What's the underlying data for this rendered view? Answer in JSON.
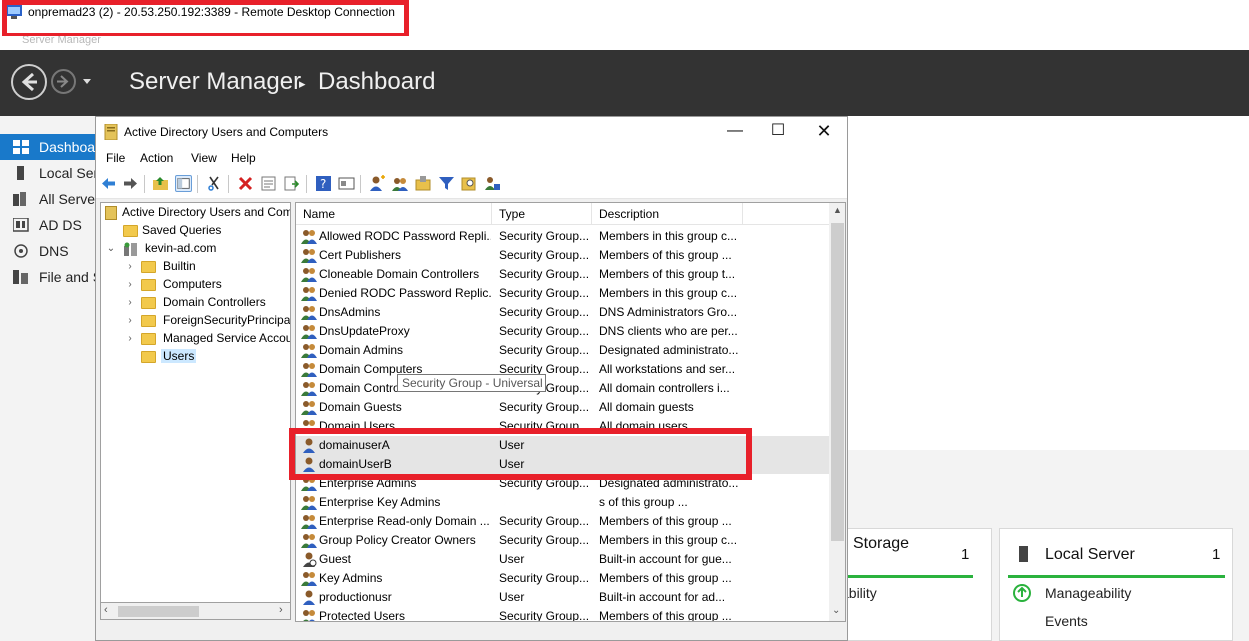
{
  "rdp": {
    "title": "onpremad23 (2) - 20.53.250.192:3389 - Remote Desktop Connection",
    "ghost_title": "Server Manager"
  },
  "header": {
    "app": "Server Manager",
    "page": "Dashboard"
  },
  "nav": [
    {
      "label": "Dashboard",
      "active": true,
      "icon": "dashboard-icon"
    },
    {
      "label": "Local Server",
      "icon": "server-icon"
    },
    {
      "label": "All Servers",
      "icon": "servers-icon"
    },
    {
      "label": "AD DS",
      "icon": "ad-ds-icon"
    },
    {
      "label": "DNS",
      "icon": "dns-icon"
    },
    {
      "label": "File and Storage Services",
      "icon": "file-storage-icon"
    }
  ],
  "tiles": {
    "storage": {
      "title": "Storage",
      "count": "1",
      "row1": "ability"
    },
    "local": {
      "title": "Local Server",
      "count": "1",
      "row1": "Manageability",
      "row2": "Events"
    }
  },
  "aduc": {
    "title": "Active Directory Users and Computers",
    "menu": [
      "File",
      "Action",
      "View",
      "Help"
    ],
    "tree": {
      "root": "Active Directory Users and Computers",
      "saved": "Saved Queries",
      "domain": "kevin-ad.com",
      "children": [
        "Builtin",
        "Computers",
        "Domain Controllers",
        "ForeignSecurityPrincipals",
        "Managed Service Accounts",
        "Users"
      ]
    },
    "columns": {
      "name": "Name",
      "type": "Type",
      "desc": "Description"
    },
    "rows": [
      {
        "name": "Allowed RODC Password Repli...",
        "type": "Security Group...",
        "desc": "Members in this group c...",
        "kind": "group"
      },
      {
        "name": "Cert Publishers",
        "type": "Security Group...",
        "desc": "Members of this group ...",
        "kind": "group"
      },
      {
        "name": "Cloneable Domain Controllers",
        "type": "Security Group...",
        "desc": "Members of this group t...",
        "kind": "group"
      },
      {
        "name": "Denied RODC Password Replic...",
        "type": "Security Group...",
        "desc": "Members in this group c...",
        "kind": "group"
      },
      {
        "name": "DnsAdmins",
        "type": "Security Group...",
        "desc": "DNS Administrators Gro...",
        "kind": "group"
      },
      {
        "name": "DnsUpdateProxy",
        "type": "Security Group...",
        "desc": "DNS clients who are per...",
        "kind": "group"
      },
      {
        "name": "Domain Admins",
        "type": "Security Group...",
        "desc": "Designated administrato...",
        "kind": "group"
      },
      {
        "name": "Domain Computers",
        "type": "Security Group...",
        "desc": "All workstations and ser...",
        "kind": "group"
      },
      {
        "name": "Domain Controllers",
        "type": "Security Group...",
        "desc": "All domain controllers i...",
        "kind": "group"
      },
      {
        "name": "Domain Guests",
        "type": "Security Group...",
        "desc": "All domain guests",
        "kind": "group"
      },
      {
        "name": "Domain Users",
        "type": "Security Group...",
        "desc": "All domain users",
        "kind": "group"
      },
      {
        "name": "domainuserA",
        "type": "User",
        "desc": "",
        "kind": "user",
        "hl": true
      },
      {
        "name": "domainUserB",
        "type": "User",
        "desc": "",
        "kind": "user",
        "hl": true
      },
      {
        "name": "Enterprise Admins",
        "type": "Security Group...",
        "desc": "Designated administrato...",
        "kind": "group"
      },
      {
        "name": "Enterprise Key Admins",
        "type": "",
        "desc": "s of this group ...",
        "kind": "group"
      },
      {
        "name": "Enterprise Read-only Domain ...",
        "type": "Security Group...",
        "desc": "Members of this group ...",
        "kind": "group"
      },
      {
        "name": "Group Policy Creator Owners",
        "type": "Security Group...",
        "desc": "Members in this group c...",
        "kind": "group"
      },
      {
        "name": "Guest",
        "type": "User",
        "desc": "Built-in account for gue...",
        "kind": "user-dis"
      },
      {
        "name": "Key Admins",
        "type": "Security Group...",
        "desc": "Members of this group ...",
        "kind": "group"
      },
      {
        "name": "productionusr",
        "type": "User",
        "desc": "Built-in account for ad...",
        "kind": "user"
      },
      {
        "name": "Protected Users",
        "type": "Security Group...",
        "desc": "Members of this group ...",
        "kind": "group"
      }
    ],
    "tooltip": "Security Group - Universal"
  },
  "colors": {
    "accent": "#1979ca",
    "highlight": "#e8202a",
    "status_green": "#2ab23d"
  }
}
